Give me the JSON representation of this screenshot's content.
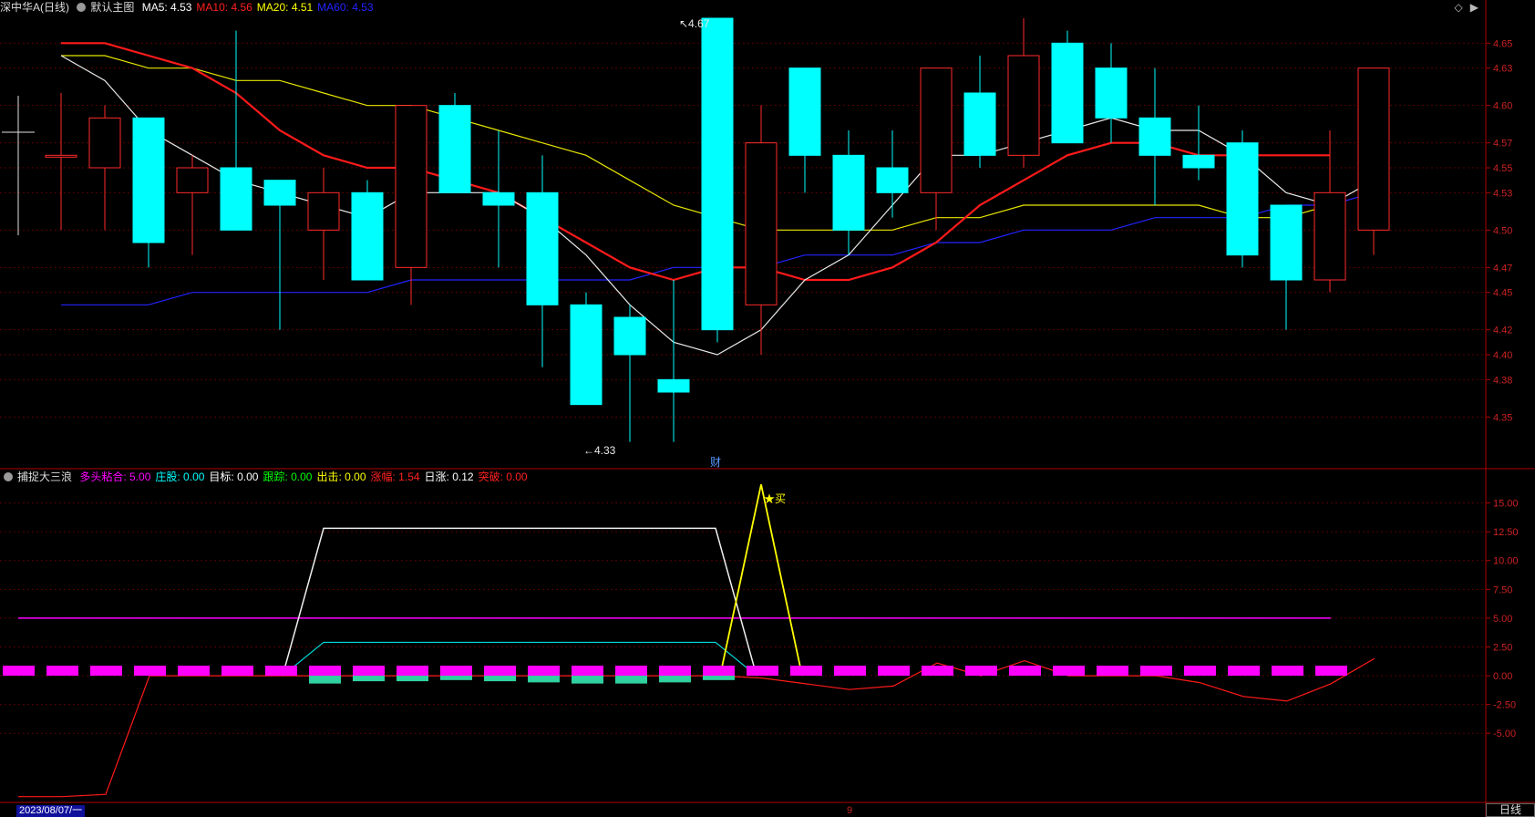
{
  "main": {
    "stock_name": "深中华A",
    "period": "(日线)",
    "template": "默认主图",
    "ma": [
      {
        "label": "MA5: 4.53",
        "color": "#ffffff"
      },
      {
        "label": "MA10: 4.56",
        "color": "#ff2020"
      },
      {
        "label": "MA20: 4.51",
        "color": "#ffff00"
      },
      {
        "label": "MA60: 4.53",
        "color": "#2323ff"
      }
    ],
    "high_label": "4.67",
    "low_label": "4.33",
    "cai_label": "财",
    "y_ticks": [
      "4.65",
      "4.63",
      "4.60",
      "4.57",
      "4.55",
      "4.53",
      "4.50",
      "4.47",
      "4.45",
      "4.42",
      "4.40",
      "4.38",
      "4.35"
    ]
  },
  "indicator": {
    "name": "捕捉大三浪",
    "params": [
      {
        "label": "多头粘合: 5.00",
        "color": "#ff00ff"
      },
      {
        "label": "庄股: 0.00",
        "color": "#00ffff"
      },
      {
        "label": "目标: 0.00",
        "color": "#ffffff"
      },
      {
        "label": "跟踪: 0.00",
        "color": "#00ff00"
      },
      {
        "label": "出击: 0.00",
        "color": "#ffff00"
      },
      {
        "label": "涨幅: 1.54",
        "color": "#ff2020"
      },
      {
        "label": "日涨: 0.12",
        "color": "#ffffff"
      },
      {
        "label": "突破: 0.00",
        "color": "#ff2020"
      }
    ],
    "buy_label": "买",
    "y_ticks": [
      "15.00",
      "12.50",
      "10.00",
      "7.50",
      "5.00",
      "2.50",
      "0.00",
      "-2.50",
      "-5.00"
    ]
  },
  "footer": {
    "date": "2023/08/07/一",
    "marker": "9",
    "period_tab": "日线"
  },
  "chart_data": {
    "type": "candlestick",
    "price_axis": [
      4.31,
      4.67
    ],
    "candles": [
      {
        "o": 4.56,
        "h": 4.61,
        "l": 4.5,
        "c": 4.56
      },
      {
        "o": 4.55,
        "h": 4.6,
        "l": 4.5,
        "c": 4.59
      },
      {
        "o": 4.59,
        "h": 4.59,
        "l": 4.47,
        "c": 4.49
      },
      {
        "o": 4.53,
        "h": 4.56,
        "l": 4.48,
        "c": 4.55
      },
      {
        "o": 4.55,
        "h": 4.66,
        "l": 4.5,
        "c": 4.5
      },
      {
        "o": 4.54,
        "h": 4.54,
        "l": 4.42,
        "c": 4.52
      },
      {
        "o": 4.5,
        "h": 4.55,
        "l": 4.46,
        "c": 4.53
      },
      {
        "o": 4.53,
        "h": 4.54,
        "l": 4.46,
        "c": 4.46
      },
      {
        "o": 4.47,
        "h": 4.6,
        "l": 4.44,
        "c": 4.6
      },
      {
        "o": 4.6,
        "h": 4.61,
        "l": 4.53,
        "c": 4.53
      },
      {
        "o": 4.53,
        "h": 4.58,
        "l": 4.47,
        "c": 4.52
      },
      {
        "o": 4.53,
        "h": 4.56,
        "l": 4.39,
        "c": 4.44
      },
      {
        "o": 4.44,
        "h": 4.45,
        "l": 4.36,
        "c": 4.36
      },
      {
        "o": 4.43,
        "h": 4.44,
        "l": 4.33,
        "c": 4.4
      },
      {
        "o": 4.38,
        "h": 4.46,
        "l": 4.33,
        "c": 4.37
      },
      {
        "o": 4.67,
        "h": 4.67,
        "l": 4.41,
        "c": 4.42
      },
      {
        "o": 4.44,
        "h": 4.6,
        "l": 4.4,
        "c": 4.57
      },
      {
        "o": 4.63,
        "h": 4.63,
        "l": 4.53,
        "c": 4.56
      },
      {
        "o": 4.56,
        "h": 4.58,
        "l": 4.48,
        "c": 4.5
      },
      {
        "o": 4.55,
        "h": 4.58,
        "l": 4.51,
        "c": 4.53
      },
      {
        "o": 4.53,
        "h": 4.63,
        "l": 4.5,
        "c": 4.63
      },
      {
        "o": 4.61,
        "h": 4.64,
        "l": 4.55,
        "c": 4.56
      },
      {
        "o": 4.56,
        "h": 4.67,
        "l": 4.55,
        "c": 4.64
      },
      {
        "o": 4.65,
        "h": 4.66,
        "l": 4.57,
        "c": 4.57
      },
      {
        "o": 4.63,
        "h": 4.65,
        "l": 4.57,
        "c": 4.59
      },
      {
        "o": 4.59,
        "h": 4.63,
        "l": 4.52,
        "c": 4.56
      },
      {
        "o": 4.56,
        "h": 4.6,
        "l": 4.54,
        "c": 4.55
      },
      {
        "o": 4.57,
        "h": 4.58,
        "l": 4.47,
        "c": 4.48
      },
      {
        "o": 4.52,
        "h": 4.52,
        "l": 4.42,
        "c": 4.46
      },
      {
        "o": 4.46,
        "h": 4.58,
        "l": 4.45,
        "c": 4.53
      },
      {
        "o": 4.5,
        "h": 4.63,
        "l": 4.48,
        "c": 4.63
      }
    ],
    "ma5": [
      4.64,
      4.62,
      4.58,
      4.56,
      4.54,
      4.53,
      4.52,
      4.51,
      4.53,
      4.53,
      4.53,
      4.51,
      4.48,
      4.44,
      4.41,
      4.4,
      4.42,
      4.46,
      4.48,
      4.52,
      4.56,
      4.56,
      4.57,
      4.58,
      4.59,
      4.58,
      4.58,
      4.56,
      4.53,
      4.52,
      4.54
    ],
    "ma10": [
      4.65,
      4.65,
      4.64,
      4.63,
      4.61,
      4.58,
      4.56,
      4.55,
      4.55,
      4.54,
      4.53,
      4.51,
      4.49,
      4.47,
      4.46,
      4.47,
      4.47,
      4.46,
      4.46,
      4.47,
      4.49,
      4.52,
      4.54,
      4.56,
      4.57,
      4.57,
      4.56,
      4.56,
      4.56,
      4.56
    ],
    "ma20": [
      4.64,
      4.64,
      4.63,
      4.63,
      4.62,
      4.62,
      4.61,
      4.6,
      4.6,
      4.59,
      4.58,
      4.57,
      4.56,
      4.54,
      4.52,
      4.51,
      4.5,
      4.5,
      4.5,
      4.5,
      4.51,
      4.51,
      4.52,
      4.52,
      4.52,
      4.52,
      4.52,
      4.51,
      4.51,
      4.52
    ],
    "ma60": [
      4.44,
      4.44,
      4.44,
      4.45,
      4.45,
      4.45,
      4.45,
      4.45,
      4.46,
      4.46,
      4.46,
      4.46,
      4.46,
      4.46,
      4.47,
      4.47,
      4.47,
      4.48,
      4.48,
      4.48,
      4.49,
      4.49,
      4.5,
      4.5,
      4.5,
      4.51,
      4.51,
      4.51,
      4.52,
      4.52,
      4.53
    ],
    "indicator_axis": [
      -11,
      17.5
    ],
    "line_5": 5.0,
    "white_line": [
      0,
      0,
      0,
      0,
      0,
      0,
      0,
      12.8,
      12.8,
      12.8,
      12.8,
      12.8,
      12.8,
      12.8,
      12.8,
      12.8,
      12.8,
      12.8,
      0.0
    ],
    "cyan_line": [
      0,
      0,
      0,
      0,
      0,
      0,
      0,
      2.9,
      2.9,
      2.9,
      2.9,
      2.9,
      2.9,
      2.9,
      2.9,
      2.9,
      2.9,
      2.9,
      0.0
    ],
    "yellow_spike": [
      0,
      16.6,
      0
    ],
    "red_line": [
      -10.5,
      -10.5,
      -10.3,
      0.0,
      0.0,
      0.0,
      0.0,
      0.0,
      0.0,
      0.0,
      0.0,
      0.0,
      0.0,
      0.0,
      0.0,
      0.0,
      0.0,
      -0.2,
      -0.7,
      -1.2,
      -0.9,
      1.1,
      0.0,
      1.3,
      0.0,
      0.0,
      0.0,
      -0.6,
      -1.8,
      -2.2,
      -0.7,
      1.5
    ],
    "down_bars": [
      -0.6,
      -0.4,
      -0.4,
      -0.3,
      -0.4,
      -0.5,
      -0.6,
      -0.6,
      -0.5,
      -0.3
    ]
  }
}
